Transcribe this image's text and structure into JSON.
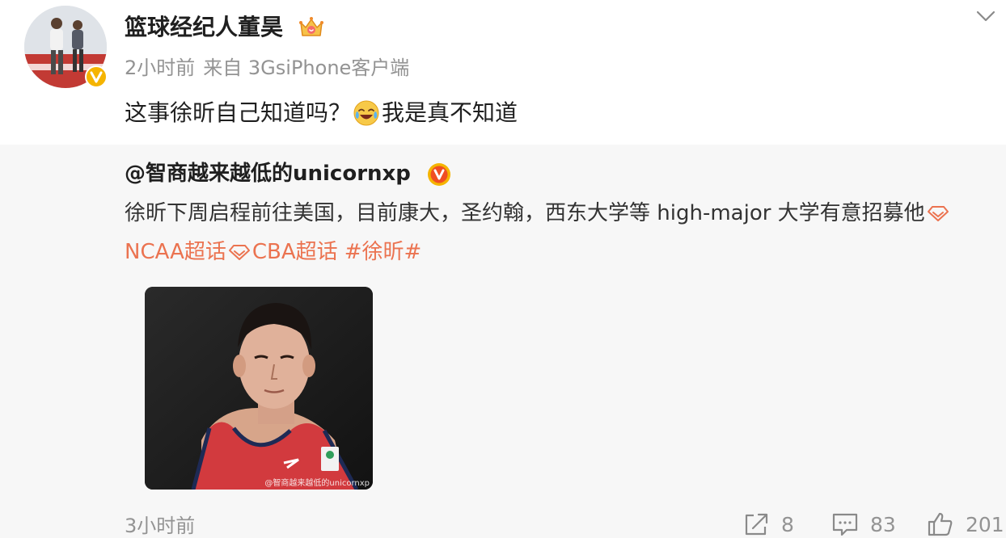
{
  "post": {
    "user_name": "篮球经纪人董昊",
    "time": "2小时前",
    "source": "来自 3GsiPhone客户端",
    "text_before": "这事徐昕自己知道吗？",
    "text_after": "我是真不知道",
    "icons": {
      "more": "chevron-down-icon",
      "member": "crown-icon",
      "verified": "verified-icon",
      "emoji": "laugh-cry-emoji"
    }
  },
  "repost": {
    "author": "@智商越来越低的unicornxp",
    "text": "徐昕下周启程前往美国，目前康大，圣约翰，西东大学等 high-major 大学有意招募他",
    "topics": [
      "NCAA超话",
      "CBA超话",
      "#徐昕#"
    ],
    "image_watermark": "@智商越来越低的unicornxp",
    "time": "3小时前",
    "actions": {
      "share_count": "8",
      "comment_count": "83",
      "like_count": "201"
    }
  },
  "colors": {
    "text_primary": "#1f1f1f",
    "text_secondary": "#939393",
    "topic_accent": "#eb7350",
    "repost_background": "#f7f7f7",
    "verified_badge": "#f5b400"
  }
}
